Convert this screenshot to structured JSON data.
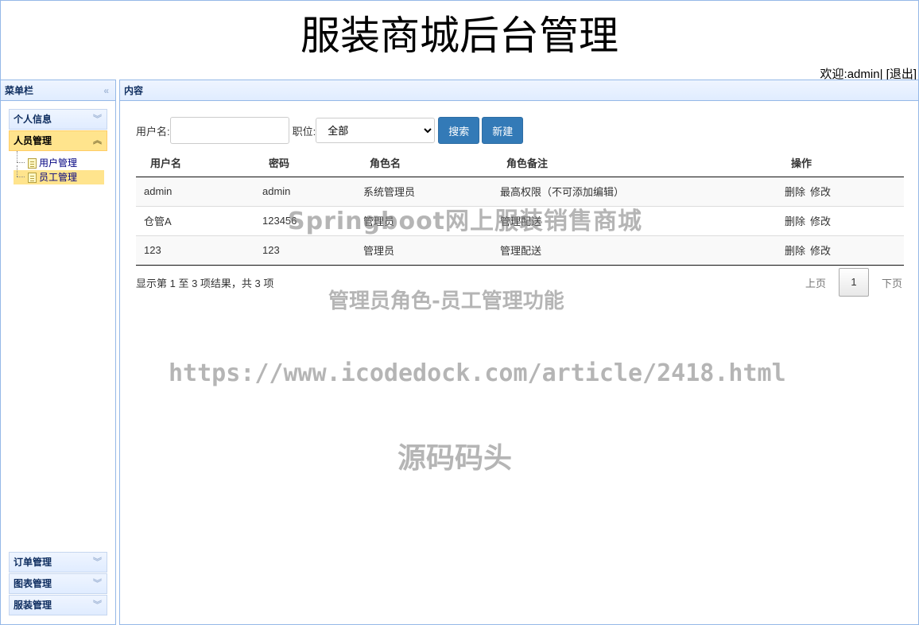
{
  "header": {
    "title": "服装商城后台管理",
    "welcome_prefix": "欢迎:",
    "username": "admin",
    "separator": "|",
    "logout": "[退出]"
  },
  "menu": {
    "title": "菜单栏",
    "collapse_icon": "double-chevron-left",
    "groups": [
      {
        "label": "个人信息"
      },
      {
        "label": "人员管理"
      },
      {
        "label": "订单管理"
      },
      {
        "label": "图表管理"
      },
      {
        "label": "服装管理"
      }
    ],
    "tree": [
      {
        "label": "用户管理"
      },
      {
        "label": "员工管理"
      }
    ]
  },
  "content": {
    "title": "内容",
    "search": {
      "username_label": "用户名:",
      "username_value": "",
      "role_label": "职位:",
      "role_selected": "全部",
      "search_button": "搜索",
      "new_button": "新建"
    },
    "table": {
      "columns": [
        "用户名",
        "密码",
        "角色名",
        "角色备注",
        "操作"
      ],
      "rows": [
        {
          "username": "admin",
          "password": "admin",
          "role": "系统管理员",
          "note": "最高权限（不可添加编辑）"
        },
        {
          "username": "仓管A",
          "password": "123456",
          "role": "管理员",
          "note": "管理配送"
        },
        {
          "username": "123",
          "password": "123",
          "role": "管理员",
          "note": "管理配送"
        }
      ],
      "delete_label": "删除",
      "edit_label": "修改"
    },
    "summary": "显示第 1 至 3 项结果，共 3 项",
    "pager": {
      "prev": "上页",
      "current": "1",
      "next": "下页"
    }
  },
  "watermarks": {
    "line1": "Springboot网上服装销售商城",
    "line2": "管理员角色-员工管理功能",
    "line3": "https://www.icodedock.com/article/2418.html",
    "line4": "源码码头"
  }
}
